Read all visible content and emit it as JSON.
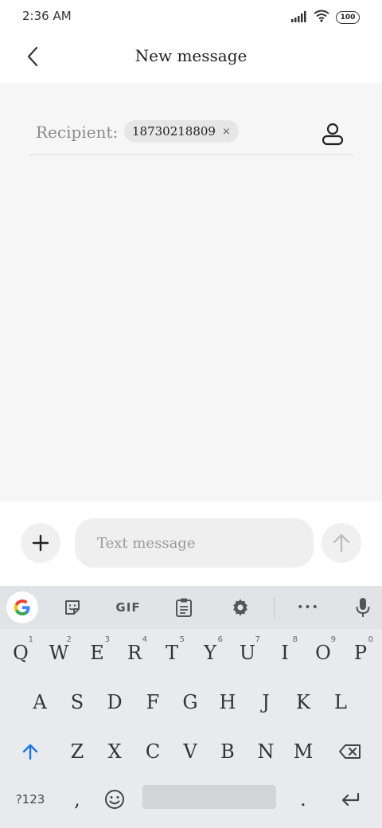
{
  "status_bar": {
    "time": "2:36 AM",
    "battery": "100"
  },
  "header": {
    "title": "New message",
    "back_icon": "chevron-left-icon"
  },
  "recipient": {
    "label": "Recipient:",
    "chip_value": "18730218809",
    "chip_remove": "×",
    "contact_icon": "person-icon"
  },
  "composer": {
    "placeholder": "Text message",
    "add_icon": "plus-icon",
    "send_icon": "arrow-up-icon"
  },
  "keyboard": {
    "toolbar": {
      "gif_label": "GIF",
      "more_label": "•••"
    },
    "row1": [
      {
        "k": "Q",
        "n": "1"
      },
      {
        "k": "W",
        "n": "2"
      },
      {
        "k": "E",
        "n": "3"
      },
      {
        "k": "R",
        "n": "4"
      },
      {
        "k": "T",
        "n": "5"
      },
      {
        "k": "Y",
        "n": "6"
      },
      {
        "k": "U",
        "n": "7"
      },
      {
        "k": "I",
        "n": "8"
      },
      {
        "k": "O",
        "n": "9"
      },
      {
        "k": "P",
        "n": "0"
      }
    ],
    "row2": [
      "A",
      "S",
      "D",
      "F",
      "G",
      "H",
      "J",
      "K",
      "L"
    ],
    "row3": [
      "Z",
      "X",
      "C",
      "V",
      "B",
      "N",
      "M"
    ],
    "row4": {
      "symbols": "?123",
      "comma": ",",
      "period": "."
    }
  },
  "colors": {
    "accent": "#1a73e8",
    "content_bg": "#f6f6f6",
    "keyboard_bg": "#e8eaed"
  }
}
